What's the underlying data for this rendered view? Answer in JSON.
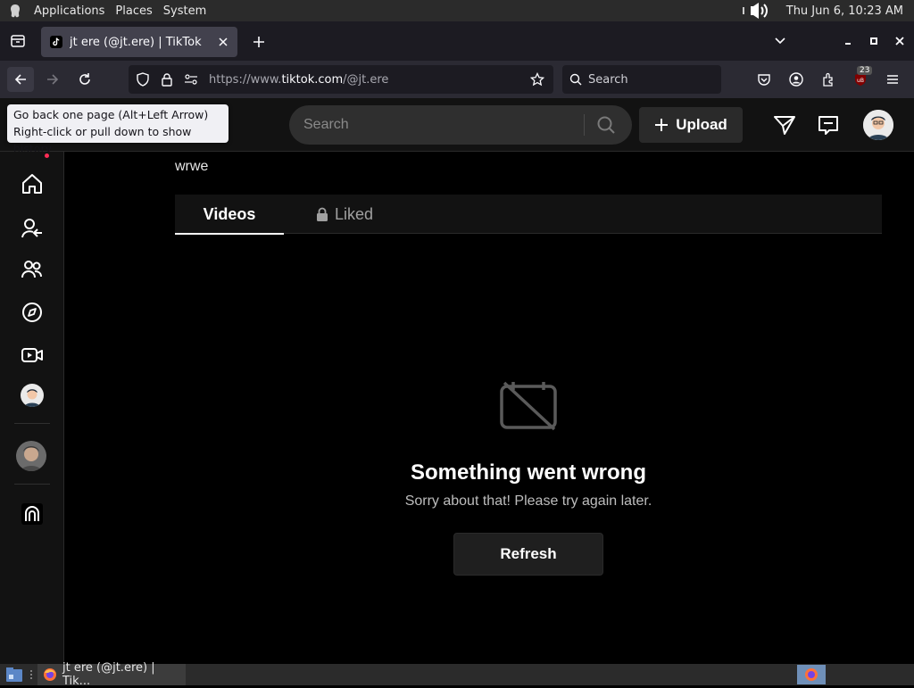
{
  "gnome_panel": {
    "applications": "Applications",
    "places": "Places",
    "system": "System",
    "clock": "Thu Jun  6, 10:23 AM"
  },
  "browser": {
    "tab_title": "jt ere (@jt.ere) | TikTok",
    "url_prefix": "https://www.",
    "url_domain": "tiktok.com",
    "url_path": "/@jt.ere",
    "search_placeholder": "Search",
    "extension_badge": "23",
    "tooltip_line1": "Go back one page (Alt+Left Arrow)",
    "tooltip_line2": "Right-click or pull down to show history"
  },
  "tiktok": {
    "search_placeholder": "Search",
    "upload_label": "Upload",
    "bio": "wrwe",
    "tabs": {
      "videos": "Videos",
      "liked": "Liked"
    },
    "error": {
      "title": "Something went wrong",
      "message": "Sorry about that! Please try again later.",
      "refresh": "Refresh"
    },
    "accent_color": "#fe2c55"
  },
  "taskbar": {
    "window_title": "jt ere (@jt.ere) | Tik..."
  }
}
